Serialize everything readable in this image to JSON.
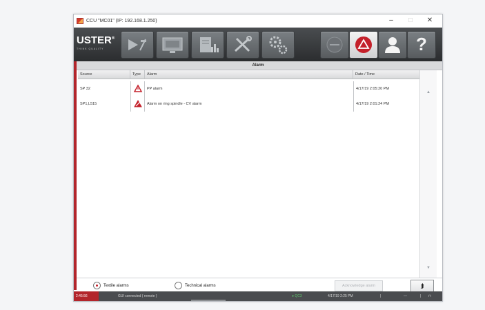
{
  "window": {
    "title": "CCU \"MC01\" (IP: 192.168.1.250)",
    "controls": {
      "minimize": "–",
      "maximize": "□",
      "close": "✕"
    }
  },
  "toolbar": {
    "logo_text": "USTER",
    "logo_reg": "®",
    "logo_sub": "THINK QUALITY",
    "buttons": [
      {
        "icon": "settings-monitor-icon"
      },
      {
        "icon": "display-icon"
      },
      {
        "icon": "reports-icon"
      },
      {
        "icon": "tools-icon"
      },
      {
        "icon": "gears-icon"
      },
      {
        "icon": "disconnected-icon"
      },
      {
        "icon": "alarm-icon",
        "active": true
      },
      {
        "icon": "user-icon"
      },
      {
        "icon": "help-icon",
        "label": "?"
      }
    ],
    "accent": "#c4202a"
  },
  "panel": {
    "title": "Alarm"
  },
  "table": {
    "columns": [
      "Source",
      "Type",
      "Alarm",
      "Date / Time"
    ],
    "rows": [
      {
        "source": "SP 32",
        "type_icon": "warning-triangle-icon",
        "alarm": "PP alarm",
        "datetime": "4/17/19 2:05:20 PM"
      },
      {
        "source": "SP1,L515",
        "type_icon": "warning-triangle-broken-icon",
        "alarm": "Alarm on ring spindle - CV alarm",
        "datetime": "4/17/19 2:01:24 PM"
      }
    ]
  },
  "scrollbar": {
    "up": "▲",
    "down": "▼"
  },
  "footer": {
    "radio_textile": "Textile alarms",
    "radio_technical": "Technical alarms",
    "selected": "textile",
    "ack_button": "Acknowledge alarm",
    "export_button": "⮭"
  },
  "status": {
    "time": "2:45:56",
    "connection": "GUI connected   ( remote )",
    "indicator": "● QC3",
    "datetime": "4/17/19 2:25 PM"
  }
}
